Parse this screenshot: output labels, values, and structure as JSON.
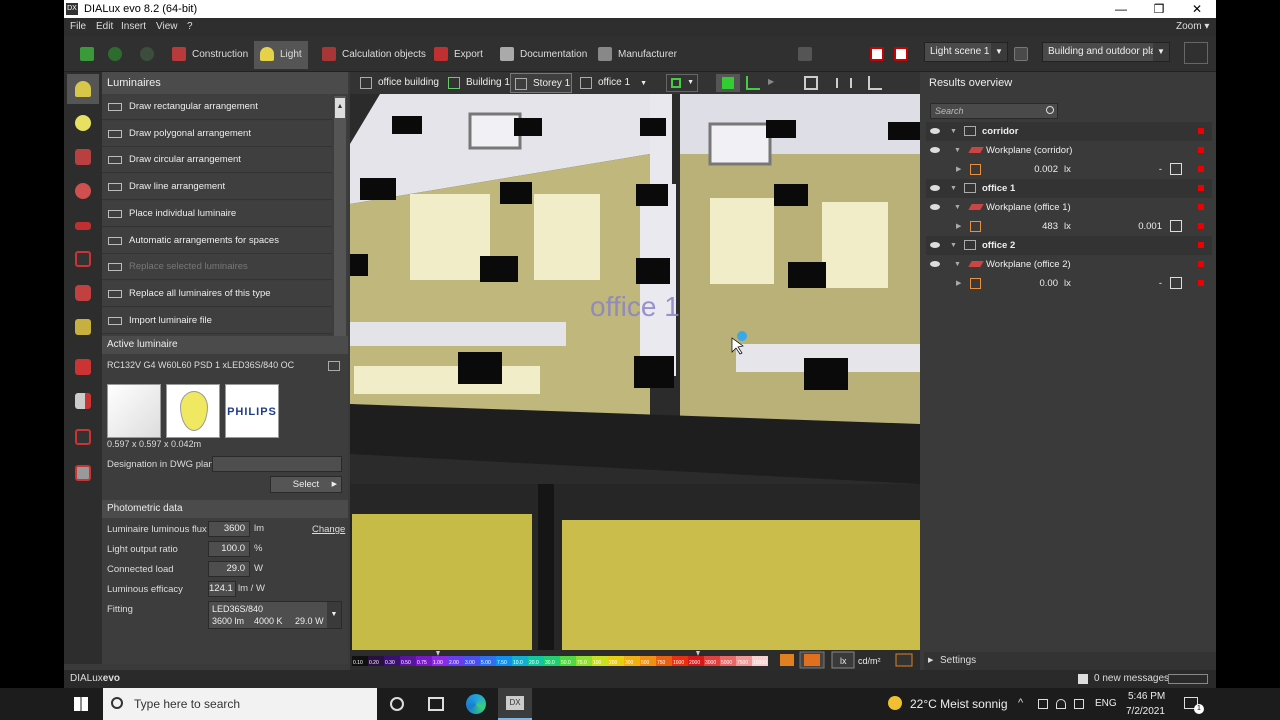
{
  "window": {
    "title": "DIALux evo 8.2  (64-bit)",
    "logo": "DX",
    "minimize": "—",
    "restore": "❒",
    "close": "✕"
  },
  "menu": {
    "items": [
      "File",
      "Edit",
      "Insert",
      "View",
      "?"
    ],
    "zoom": "Zoom ▾"
  },
  "toolbar": {
    "tabs": [
      "Construction",
      "Light",
      "Calculation objects",
      "Export",
      "Documentation",
      "Manufacturer"
    ],
    "active_tab": "Light",
    "light_scene": "Light scene 1",
    "view_select": "Building and outdoor pla..."
  },
  "luminaires_panel": {
    "title": "Luminaires",
    "items": [
      "Draw rectangular arrangement",
      "Draw polygonal arrangement",
      "Draw circular arrangement",
      "Draw line arrangement",
      "Place individual luminaire",
      "Automatic arrangements for spaces",
      "Replace selected luminaires",
      "Replace all luminaires of this type",
      "Import luminaire file"
    ],
    "disabled_index": 6
  },
  "active_luminaire": {
    "title": "Active luminaire",
    "name": "RC132V G4 W60L60 PSD 1 xLED36S/840 OC",
    "dimensions": "0.597 x 0.597 x 0.042m",
    "brand": "PHILIPS",
    "designation_label": "Designation in DWG plan",
    "designation_value": "",
    "select_button": "Select"
  },
  "photometric": {
    "title": "Photometric data",
    "flux_label": "Luminaire luminous flux",
    "flux_value": "3600",
    "flux_unit": "lm",
    "change_link": "Change",
    "lor_label": "Light output ratio",
    "lor_value": "100.0",
    "lor_unit": "%",
    "load_label": "Connected load",
    "load_value": "29.0",
    "load_unit": "W",
    "efficacy_label": "Luminous efficacy",
    "efficacy_value": "124.1",
    "efficacy_unit": "lm / W",
    "fitting_label": "Fitting",
    "fitting_line1": "LED36S/840",
    "fitting_line2": "3600 lm    4000 K     29.0 W"
  },
  "viewport": {
    "breadcrumbs": [
      "office building",
      "Building 1",
      "Storey 1",
      "office 1"
    ],
    "room_label": "office 1",
    "legend_values": [
      "0.10",
      "0.20",
      "0.30",
      "0.50",
      "0.75",
      "1.00",
      "2.00",
      "3.00",
      "5.00",
      "7.50",
      "10.0",
      "20.0",
      "30.0",
      "50.0",
      "75.0",
      "100",
      "200",
      "300",
      "500",
      "750",
      "1000",
      "2000",
      "3000",
      "5000",
      "7500",
      "10000"
    ],
    "unit_lx": "lx",
    "unit_cd": "cd/m²"
  },
  "results": {
    "title": "Results overview",
    "search_placeholder": "Search",
    "rows": [
      {
        "type": "group",
        "label": "corridor"
      },
      {
        "type": "workplane",
        "label": "Workplane (corridor)"
      },
      {
        "type": "value",
        "left": "0.002",
        "unit": "lx",
        "right": "-"
      },
      {
        "type": "group",
        "label": "office 1"
      },
      {
        "type": "workplane",
        "label": "Workplane (office 1)"
      },
      {
        "type": "value",
        "left": "483",
        "unit": "lx",
        "right": "0.001"
      },
      {
        "type": "group",
        "label": "office 2"
      },
      {
        "type": "workplane",
        "label": "Workplane (office 2)"
      },
      {
        "type": "value",
        "left": "0.00",
        "unit": "lx",
        "right": "-"
      }
    ],
    "settings": "Settings"
  },
  "statusbar": {
    "brand": "DIALux",
    "brand_suffix": "evo",
    "messages": "0 new messages"
  },
  "taskbar": {
    "search_placeholder": "Type here to search",
    "weather": "22°C  Meist sonnig",
    "language": "ENG",
    "time": "5:46 PM",
    "date": "7/2/2021",
    "notif_count": "1"
  },
  "colors": {
    "panel": "#3d3d3d",
    "accent_red": "#e00000",
    "floor": "#b9b178",
    "ceiling_tiles": "#111111"
  }
}
